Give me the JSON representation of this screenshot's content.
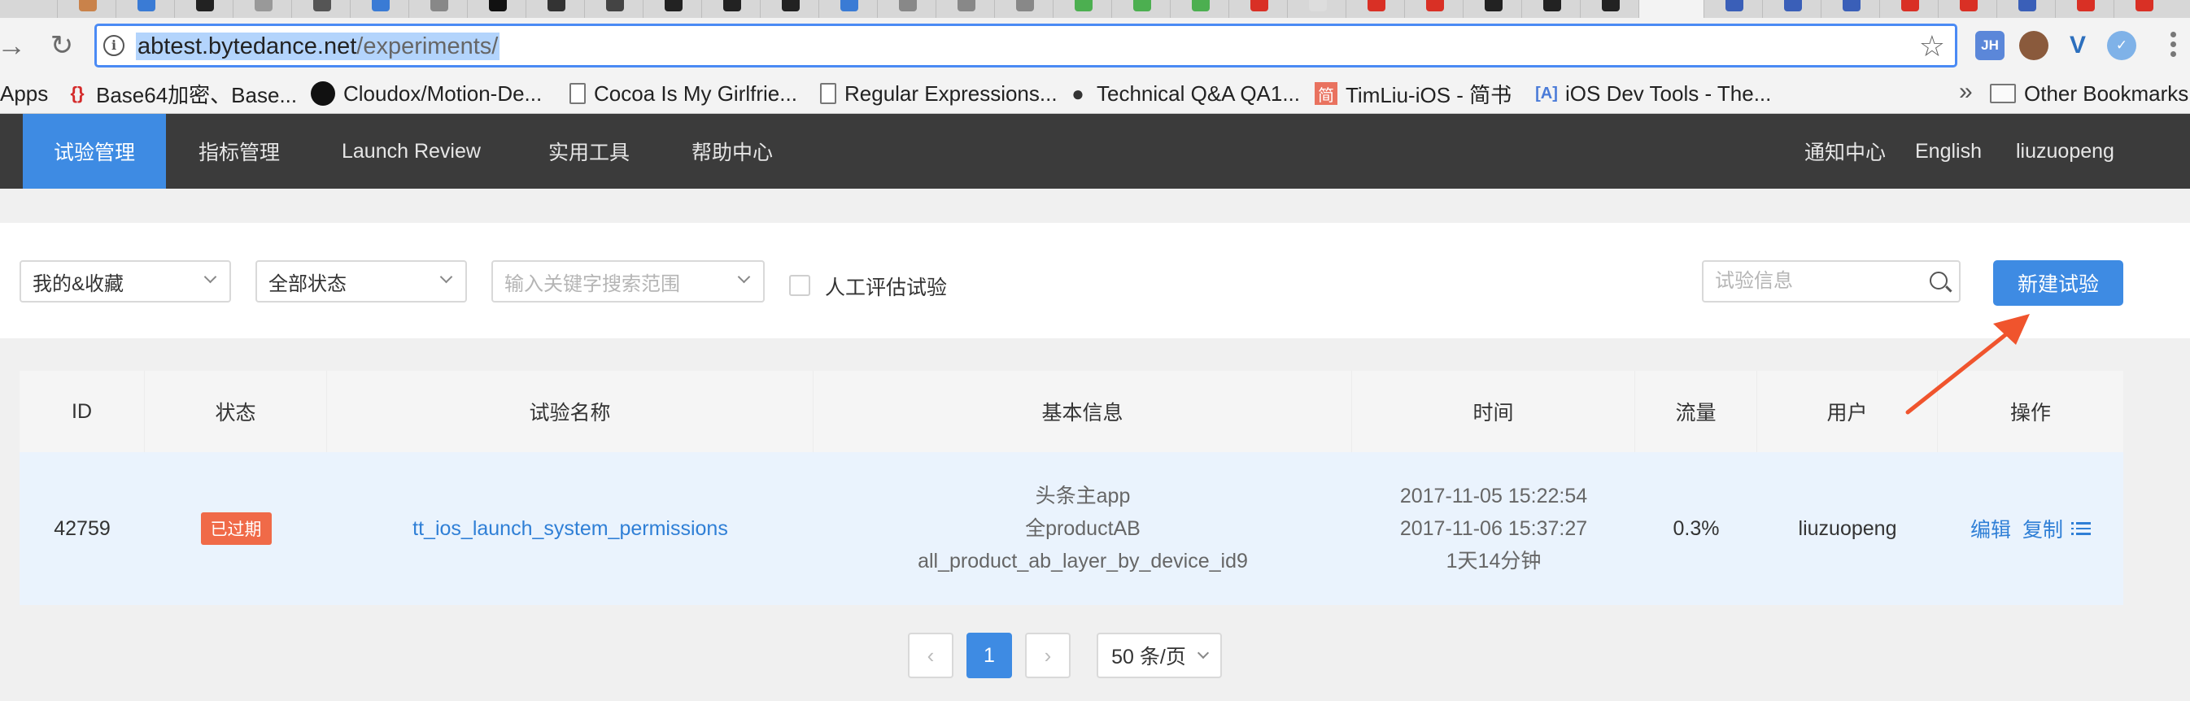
{
  "browser": {
    "url_host": "abtest.bytedance.net",
    "url_path": "/experiments/",
    "bookmarks": [
      {
        "label": "Apps",
        "icon": "apps-grid-icon"
      },
      {
        "label": "Base64加密、Base...",
        "icon": "braces-icon"
      },
      {
        "label": "Cloudox/Motion-De...",
        "icon": "github-icon"
      },
      {
        "label": "Cocoa Is My Girlfrie...",
        "icon": "document-icon"
      },
      {
        "label": "Regular Expressions...",
        "icon": "document-icon"
      },
      {
        "label": "Technical Q&A QA1...",
        "icon": "apple-icon"
      },
      {
        "label": "TimLiu-iOS - 简书",
        "icon": "jianshu-icon"
      },
      {
        "label": "iOS Dev Tools - The...",
        "icon": "ios-dev-icon"
      }
    ],
    "bookmarks_more": "»",
    "other_bookmarks": "Other Bookmarks",
    "extensions": [
      {
        "name": "jh-extension-icon",
        "text": "JH",
        "color": "#5b87d9"
      },
      {
        "name": "avatar-extension-icon",
        "text": "",
        "color": "#8a5a3c"
      },
      {
        "name": "vue-devtools-icon",
        "text": "V",
        "color": "#2c6fbd"
      },
      {
        "name": "checkmark-extension-icon",
        "text": "✓",
        "color": "#7fb2e8"
      }
    ]
  },
  "nav": {
    "items": [
      "试验管理",
      "指标管理",
      "Launch Review",
      "实用工具",
      "帮助中心"
    ],
    "right": [
      "通知中心",
      "English",
      "liuzuopeng"
    ]
  },
  "filters": {
    "scope": "我的&收藏",
    "status": "全部状态",
    "keyword_placeholder": "输入关键字搜索范围",
    "manual_eval_label": "人工评估试验",
    "search_placeholder": "试验信息",
    "new_button": "新建试验"
  },
  "table": {
    "columns": [
      "ID",
      "状态",
      "试验名称",
      "基本信息",
      "时间",
      "流量",
      "用户",
      "操作"
    ],
    "rows": [
      {
        "id": "42759",
        "status": "已过期",
        "name": "tt_ios_launch_system_permissions",
        "info": [
          "头条主app",
          "全productAB",
          "all_product_ab_layer_by_device_id9"
        ],
        "time": [
          "2017-11-05 15:22:54",
          "2017-11-06 15:37:27",
          "1天14分钟"
        ],
        "traffic": "0.3%",
        "user": "liuzuopeng",
        "actions": [
          "编辑",
          "复制"
        ]
      }
    ]
  },
  "pagination": {
    "prev": "‹",
    "current": "1",
    "next": "›",
    "page_size": "50 条/页"
  },
  "colors": {
    "accent": "#3e8be3",
    "header_bg": "#3b3b3b",
    "expired_badge": "#f06a48",
    "annotation_arrow": "#f0542d"
  }
}
